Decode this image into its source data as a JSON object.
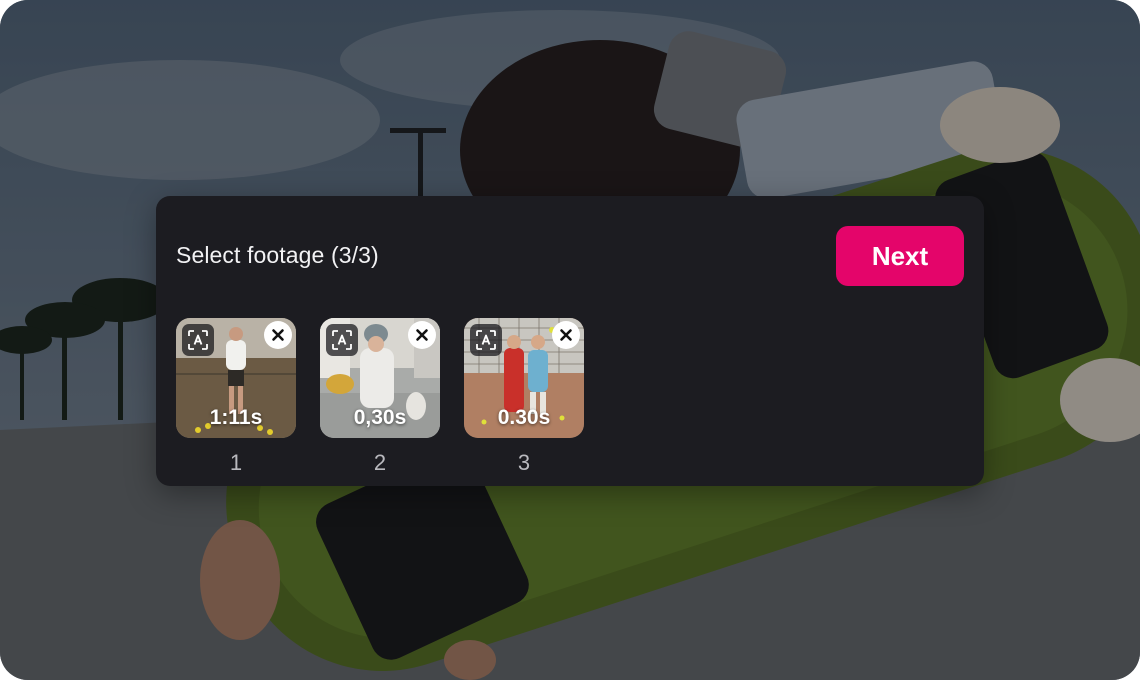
{
  "dialog": {
    "title": "Select footage (3/3)",
    "next_label": "Next",
    "accent_color": "#e4056a"
  },
  "clips": [
    {
      "duration": "1:11s",
      "index": "1",
      "ai_icon": "ai-recognition-icon",
      "remove_icon": "close-icon"
    },
    {
      "duration": "0,30s",
      "index": "2",
      "ai_icon": "ai-recognition-icon",
      "remove_icon": "close-icon"
    },
    {
      "duration": "0.30s",
      "index": "3",
      "ai_icon": "ai-recognition-icon",
      "remove_icon": "close-icon"
    }
  ]
}
